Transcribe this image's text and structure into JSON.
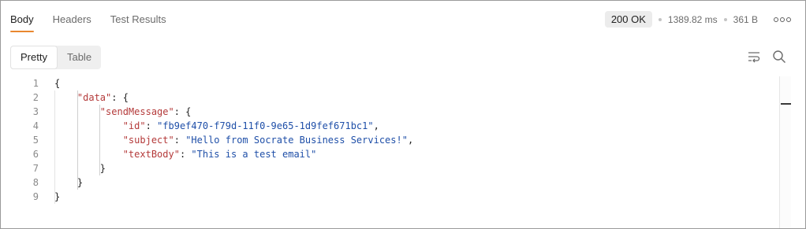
{
  "tabs": [
    {
      "label": "Body",
      "active": true
    },
    {
      "label": "Headers",
      "active": false
    },
    {
      "label": "Test Results",
      "active": false
    }
  ],
  "response": {
    "status": "200 OK",
    "time": "1389.82 ms",
    "size": "361 B"
  },
  "view": {
    "options": [
      "Pretty",
      "Table"
    ],
    "selected": "Pretty"
  },
  "toolbar": {
    "icons": [
      "wrap-lines-icon",
      "search-icon"
    ]
  },
  "code": {
    "line_numbers": [
      "1",
      "2",
      "3",
      "4",
      "5",
      "6",
      "7",
      "8",
      "9"
    ],
    "lines": [
      [
        {
          "t": "{",
          "c": "p"
        }
      ],
      [
        {
          "t": "    ",
          "c": "p"
        },
        {
          "t": "\"data\"",
          "c": "k"
        },
        {
          "t": ": {",
          "c": "p"
        }
      ],
      [
        {
          "t": "        ",
          "c": "p"
        },
        {
          "t": "\"sendMessage\"",
          "c": "k"
        },
        {
          "t": ": {",
          "c": "p"
        }
      ],
      [
        {
          "t": "            ",
          "c": "p"
        },
        {
          "t": "\"id\"",
          "c": "k"
        },
        {
          "t": ": ",
          "c": "p"
        },
        {
          "t": "\"fb9ef470-f79d-11f0-9e65-1d9fef671bc1\"",
          "c": "s"
        },
        {
          "t": ",",
          "c": "p"
        }
      ],
      [
        {
          "t": "            ",
          "c": "p"
        },
        {
          "t": "\"subject\"",
          "c": "k"
        },
        {
          "t": ": ",
          "c": "p"
        },
        {
          "t": "\"Hello from Socrate Business Services!\"",
          "c": "s"
        },
        {
          "t": ",",
          "c": "p"
        }
      ],
      [
        {
          "t": "            ",
          "c": "p"
        },
        {
          "t": "\"textBody\"",
          "c": "k"
        },
        {
          "t": ": ",
          "c": "p"
        },
        {
          "t": "\"This is a test email\"",
          "c": "s"
        }
      ],
      [
        {
          "t": "        ",
          "c": "p"
        },
        {
          "t": "}",
          "c": "p"
        }
      ],
      [
        {
          "t": "    ",
          "c": "p"
        },
        {
          "t": "}",
          "c": "p"
        }
      ],
      [
        {
          "t": "}",
          "c": "p"
        }
      ]
    ]
  },
  "colors": {
    "accent": "#e9872f",
    "key": "#b43a3a",
    "string": "#1f4fa8"
  }
}
